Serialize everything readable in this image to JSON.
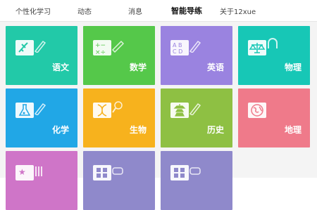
{
  "tabs": [
    {
      "label": "个性化学习"
    },
    {
      "label": "动态"
    },
    {
      "label": "消息"
    },
    {
      "label": "智能导练"
    },
    {
      "label": "关于12xue"
    }
  ],
  "subjects": [
    {
      "label": "语文",
      "color": "#22c9a8",
      "icon": "chinese-brush-icon"
    },
    {
      "label": "数学",
      "color": "#55c84a",
      "icon": "math-operators-icon"
    },
    {
      "label": "英语",
      "color": "#9a83e0",
      "icon": "abcd-letters-icon"
    },
    {
      "label": "物理",
      "color": "#17c7b6",
      "icon": "balance-scale-icon"
    },
    {
      "label": "化学",
      "color": "#21a7e6",
      "icon": "flask-icon"
    },
    {
      "label": "生物",
      "color": "#f7b21d",
      "icon": "dna-icon"
    },
    {
      "label": "历史",
      "color": "#8ec043",
      "icon": "pagoda-icon"
    },
    {
      "label": "地理",
      "color": "#ef7a8a",
      "icon": "globe-icon"
    },
    {
      "label": "",
      "color": "#cf75c8",
      "icon": "stars-icon"
    },
    {
      "label": "",
      "color": "#8f89cb",
      "icon": "grid-apps-icon"
    },
    {
      "label": "",
      "color": "#8f89cb",
      "icon": "grid-apps-icon"
    }
  ]
}
